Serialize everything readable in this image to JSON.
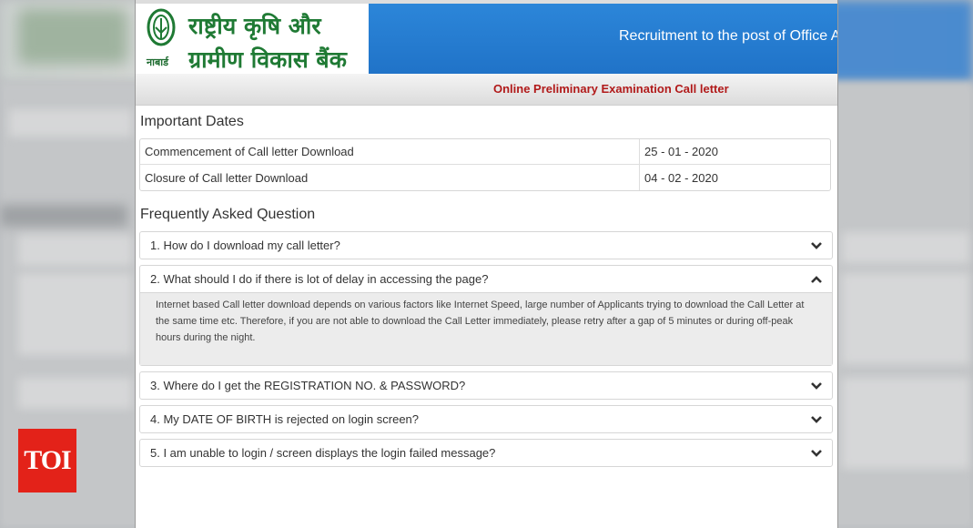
{
  "watermark": "TOI",
  "header": {
    "org_name_line1": "राष्ट्रीय कृषि और",
    "org_name_line2": "ग्रामीण विकास बैंक",
    "emblem_label": "नाबार्ड",
    "title": "Recruitment to the post of Office A"
  },
  "subheader": {
    "title": "Online Preliminary Examination Call letter"
  },
  "important_dates": {
    "heading": "Important Dates",
    "rows": [
      {
        "label": "Commencement of Call letter Download",
        "value": "25 - 01 - 2020"
      },
      {
        "label": "Closure of Call letter Download",
        "value": "04 - 02 - 2020"
      }
    ]
  },
  "faq": {
    "heading": "Frequently Asked Question",
    "items": [
      {
        "question": "1. How do I download my call letter?",
        "expanded": false
      },
      {
        "question": "2. What should I do if there is lot of delay in accessing the page?",
        "expanded": true,
        "answer": "Internet based Call letter download depends on various factors like Internet Speed, large number of Applicants trying to download the Call Letter at the same time etc. Therefore, if you are not able to download the Call Letter immediately, please retry after a gap of 5 minutes or during off-peak hours during the night."
      },
      {
        "question": "3. Where do I get the REGISTRATION NO. & PASSWORD?",
        "expanded": false
      },
      {
        "question": "4. My DATE OF BIRTH is rejected on login screen?",
        "expanded": false
      },
      {
        "question": "5. I am unable to login / screen displays the login failed message?",
        "expanded": false
      }
    ]
  },
  "colors": {
    "brand_green": "#1f7a34",
    "header_blue": "#2479cc",
    "subtitle_red": "#b11a1a",
    "watermark_red": "#e32219"
  },
  "icons": {
    "collapsed": "chevron-down-icon",
    "expanded": "chevron-up-icon"
  }
}
